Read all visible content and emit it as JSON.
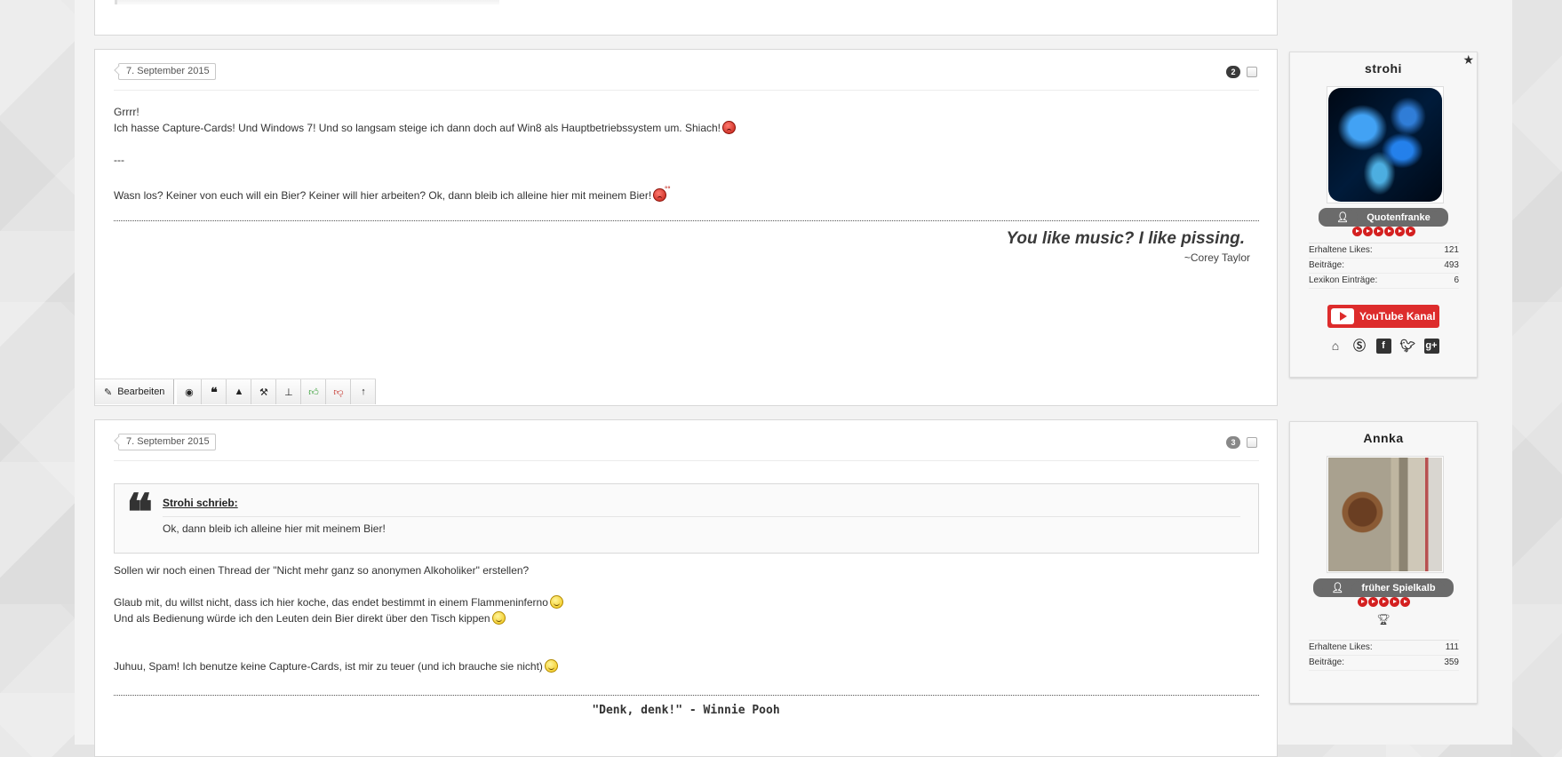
{
  "post1": {
    "date": "7. September 2015",
    "number": "2",
    "lines": [
      "Grrrr!",
      "Ich hasse Capture-Cards! Und Windows 7! Und so langsam steige ich dann doch auf Win8 als Hauptbetriebssystem um. Shiach!",
      "---",
      "Wasn los? Keiner von euch will ein Bier? Keiner will hier arbeiten? Ok, dann bleib ich alleine hier mit meinem Bier!"
    ],
    "signature_quote": "You like music? I like pissing.",
    "signature_author": "~Corey Taylor",
    "toolbar": {
      "edit_label": "Bearbeiten",
      "icons": [
        "globe-icon",
        "quote-icon",
        "warning-icon",
        "hammer-icon",
        "pin-icon",
        "thumbs-up-icon",
        "thumbs-down-icon",
        "arrow-up-icon"
      ]
    }
  },
  "post2": {
    "date": "7. September 2015",
    "number": "3",
    "quote": {
      "author": "Strohi schrieb:",
      "text": "Ok, dann bleib ich alleine hier mit meinem Bier!"
    },
    "lines": [
      "Sollen wir noch einen Thread der \"Nicht mehr ganz so anonymen Alkoholiker\" erstellen?",
      "Glaub mit, du willst nicht, dass ich hier koche, das endet bestimmt in einem Flammeninferno",
      "Und als Bedienung würde ich den Leuten dein Bier direkt über den Tisch kippen",
      "Juhuu, Spam! Ich benutze keine Capture-Cards, ist mir zu teuer (und ich brauche sie nicht)"
    ],
    "signature": "\"Denk, denk!\" - Winnie Pooh"
  },
  "user1": {
    "name": "strohi",
    "rank": "Quotenfranke",
    "rank_star_count": 6,
    "stats": [
      {
        "label": "Erhaltene Likes:",
        "value": "121"
      },
      {
        "label": "Beiträge:",
        "value": "493"
      },
      {
        "label": "Lexikon Einträge:",
        "value": "6"
      }
    ],
    "youtube_label": "YouTube Kanal",
    "social_icons": [
      "home-icon",
      "skype-icon",
      "facebook-icon",
      "twitter-icon",
      "google-plus-icon"
    ]
  },
  "user2": {
    "name": "Annka",
    "rank": "früher Spielkalb",
    "rank_star_count": 5,
    "stats": [
      {
        "label": "Erhaltene Likes:",
        "value": "111"
      },
      {
        "label": "Beiträge:",
        "value": "359"
      }
    ]
  },
  "colors": {
    "accent_red": "#dd2c2c",
    "rank_badge": "#6b6b6b",
    "thumbs_up": "#2d9a2d",
    "thumbs_down": "#c0241b"
  }
}
